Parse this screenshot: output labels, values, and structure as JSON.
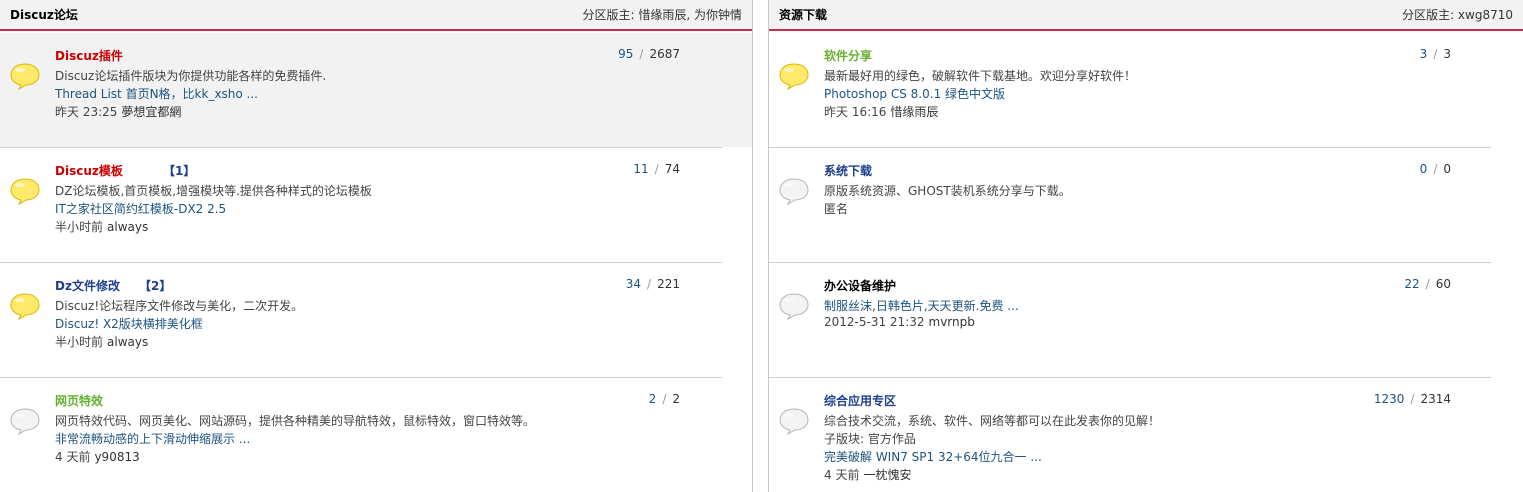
{
  "left_panel": {
    "title": "Discuz论坛",
    "moderators": "分区版主: 惜缘雨辰, 为你钟情",
    "forums": [
      {
        "name": "Discuz插件",
        "name_color": "#cc0000",
        "today": "",
        "desc": "Discuz论坛插件版块为你提供功能各样的免费插件.",
        "sub": "",
        "last_post": "Thread List 首页N格，比kk_xsho ...",
        "time": "昨天 23:25",
        "author": "夢想宜都網",
        "threads": "95",
        "posts": "2687",
        "icon": "bubble-new-icon",
        "highlight": true
      },
      {
        "name": "Discuz模板",
        "name_color": "#cc0000",
        "today": "【1】",
        "desc": "DZ论坛模板,首页模板,增强模块等.提供各种样式的论坛模板",
        "sub": "",
        "last_post": "IT之家社区简约红模板-DX2 2.5",
        "time": "半小时前",
        "author": "always",
        "threads": "11",
        "posts": "74",
        "icon": "bubble-new-icon",
        "highlight": false
      },
      {
        "name": "Dz文件修改",
        "name_color": "#1d3f8c",
        "today": "【2】",
        "desc": "Discuz!论坛程序文件修改与美化，二次开发。",
        "sub": "",
        "last_post": "Discuz! X2版块横排美化框",
        "time": "半小时前",
        "author": "always",
        "threads": "34",
        "posts": "221",
        "icon": "bubble-new-icon",
        "highlight": false
      },
      {
        "name": "网页特效",
        "name_color": "#66b032",
        "today": "",
        "desc": "网页特效代码、网页美化、网站源码，提供各种精美的导航特效，鼠标特效，窗口特效等。",
        "sub": "",
        "last_post": "非常流畅动感的上下滑动伸缩展示 ...",
        "time": "4 天前",
        "author": "y90813",
        "threads": "2",
        "posts": "2",
        "icon": "bubble-old-icon",
        "highlight": false
      }
    ]
  },
  "right_panel": {
    "title": "资源下载",
    "moderators": "分区版主: xwg8710",
    "forums": [
      {
        "name": "软件分享",
        "name_color": "#66b032",
        "today": "",
        "desc": "最新最好用的绿色，破解软件下载基地。欢迎分享好软件！",
        "sub": "",
        "last_post": "Photoshop CS 8.0.1 绿色中文版",
        "time": "昨天 16:16",
        "author": "惜缘雨辰",
        "threads": "3",
        "posts": "3",
        "icon": "bubble-new-icon",
        "highlight": false
      },
      {
        "name": "系统下载",
        "name_color": "#1d3f8c",
        "today": "",
        "desc": "原版系统资源、GHOST装机系统分享与下载。",
        "sub": "",
        "last_post": "",
        "time": "匿名",
        "author": "",
        "threads": "0",
        "posts": "0",
        "icon": "bubble-old-icon",
        "highlight": false
      },
      {
        "name": "办公设备维护",
        "name_color": "#000000",
        "today": "",
        "desc": "",
        "sub": "",
        "last_post": "制服丝沫,日韩色片,天天更新.免费 ...",
        "time": "2012-5-31 21:32",
        "author": "mvrnpb",
        "threads": "22",
        "posts": "60",
        "icon": "bubble-old-icon",
        "highlight": false
      },
      {
        "name": "综合应用专区",
        "name_color": "#1d3f8c",
        "today": "",
        "desc": "综合技术交流，系统、软件、网络等都可以在此发表你的见解！",
        "sub": "子版块: 官方作品",
        "last_post": "完美破解 WIN7 SP1 32+64位九合一 ...",
        "time": "4 天前",
        "author": "一枕愧安",
        "threads": "1230",
        "posts": "2314",
        "icon": "bubble-old-icon",
        "highlight": false
      }
    ]
  }
}
